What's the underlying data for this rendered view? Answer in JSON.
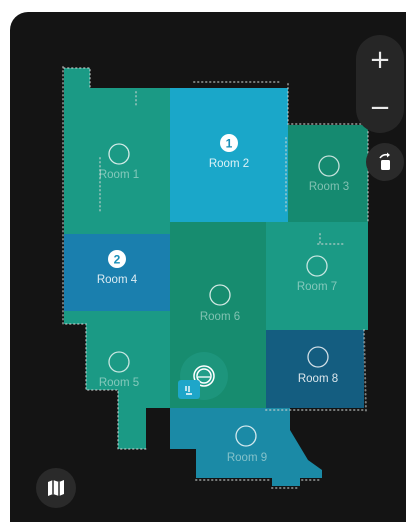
{
  "controls": {
    "zoom_in_label": "+",
    "zoom_out_label": "−"
  },
  "colors": {
    "background": "#141414",
    "room_teal": "#1a9a84",
    "room_selected_cyan": "#1aa7c9",
    "room_selected_blue": "#1a7fae",
    "room_dark_blue": "#145d80"
  },
  "rooms": [
    {
      "id": "room1",
      "name": "Room 1",
      "selected": false
    },
    {
      "id": "room2",
      "name": "Room 2",
      "selected": true,
      "order": "1"
    },
    {
      "id": "room3",
      "name": "Room 3",
      "selected": false
    },
    {
      "id": "room4",
      "name": "Room 4",
      "selected": true,
      "order": "2"
    },
    {
      "id": "room5",
      "name": "Room 5",
      "selected": false
    },
    {
      "id": "room6",
      "name": "Room 6",
      "selected": false
    },
    {
      "id": "room7",
      "name": "Room 7",
      "selected": false
    },
    {
      "id": "room8",
      "name": "Room 8",
      "selected": false
    },
    {
      "id": "room9",
      "name": "Room 9",
      "selected": false
    }
  ],
  "icons": {
    "robot": "robot-vacuum-icon",
    "dock": "charging-dock-icon",
    "rotate": "rotate-map-icon",
    "maps": "map-icon"
  }
}
